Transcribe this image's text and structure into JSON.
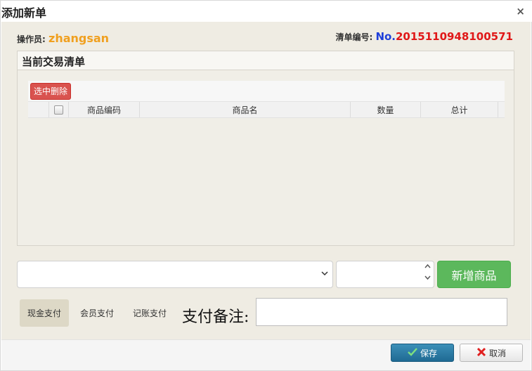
{
  "dialog": {
    "title": "添加新单",
    "close_glyph": "×"
  },
  "operator": {
    "label": "操作员:",
    "name": "zhangsan"
  },
  "order": {
    "label": "清单编号:",
    "prefix": "No.",
    "number": "2015110948100571"
  },
  "panel": {
    "title": "当前交易清单"
  },
  "toolbar": {
    "delete_selected": "选中删除"
  },
  "table": {
    "columns": [
      "商品编码",
      "商品名",
      "数量",
      "总计"
    ],
    "rows": []
  },
  "product_form": {
    "select_value": "",
    "quantity_value": "",
    "add_button": "新增商品"
  },
  "payment": {
    "options": [
      "现金支付",
      "会员支付",
      "记账支付"
    ],
    "selected": "现金支付"
  },
  "remark": {
    "label": "支付备注:",
    "value": ""
  },
  "footer": {
    "save": "保存",
    "cancel": "取消"
  },
  "colors": {
    "operator_name": "#f0a020",
    "order_prefix": "#1f3fd9",
    "order_number": "#e01818",
    "delete_button": "#d9534f",
    "add_button": "#5cb85c",
    "save_button": "#1f6a93"
  }
}
